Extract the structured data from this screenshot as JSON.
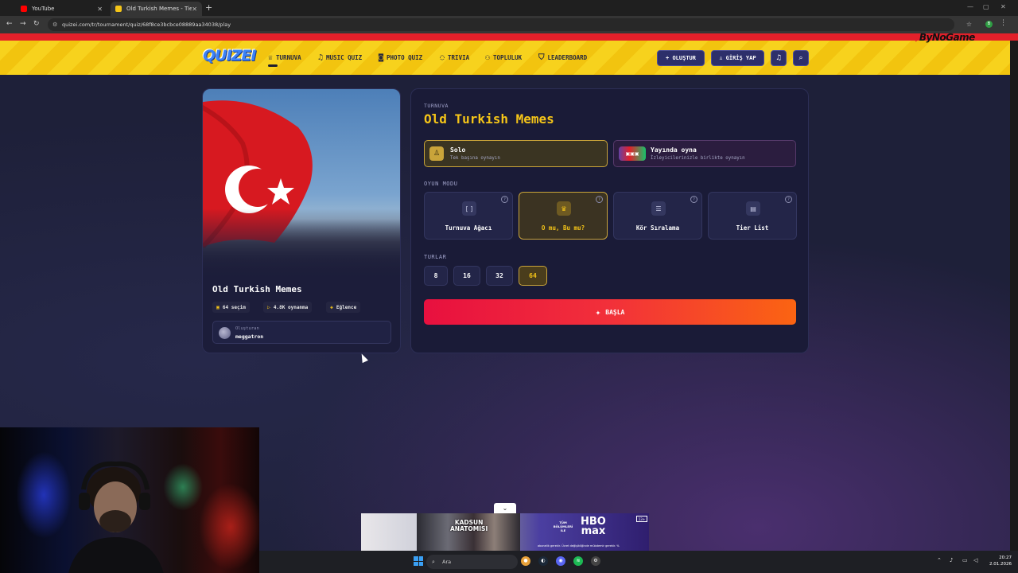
{
  "browser": {
    "tabs": [
      {
        "title": "YouTube",
        "favicon_color": "#ff0000",
        "active": false
      },
      {
        "title": "Old Turkish Memes - Tier List |",
        "favicon_color": "#f5c518",
        "active": true
      }
    ],
    "url": "quizei.com/tr/tournament/quiz/68f8ce3bcbce08889aa34038/play",
    "extension_letter": "B"
  },
  "header": {
    "logo": "QUIZEI",
    "nav": [
      {
        "label": "TURNUVA",
        "icon": "trophy-icon",
        "glyph": "♕"
      },
      {
        "label": "MUSIC QUIZ",
        "icon": "music-icon",
        "glyph": "♫"
      },
      {
        "label": "PHOTO QUIZ",
        "icon": "camera-icon",
        "glyph": "◙"
      },
      {
        "label": "TRIVIA",
        "icon": "chat-icon",
        "glyph": "◌"
      },
      {
        "label": "TOPLULUK",
        "icon": "users-icon",
        "glyph": "⚇"
      },
      {
        "label": "LEADERBOARD",
        "icon": "shield-icon",
        "glyph": "⛉"
      }
    ],
    "create_label": "+ OLUŞTUR",
    "login_label": "GİRİŞ YAP",
    "overlay_brand": "ByNoGame"
  },
  "quiz_card": {
    "title": "Old Turkish Memes",
    "stats": [
      {
        "icon": "images-icon",
        "glyph": "▣",
        "label": "64 seçim"
      },
      {
        "icon": "play-icon",
        "glyph": "▷",
        "label": "4.8K oynanma"
      },
      {
        "icon": "tag-icon",
        "glyph": "◈",
        "label": "Eğlence"
      }
    ],
    "creator_label": "Oluşturan",
    "creator_name": "meggatron"
  },
  "setup": {
    "kicker": "TURNUVA",
    "title": "Old Turkish Memes",
    "play_options": [
      {
        "title": "Solo",
        "subtitle": "Tek başına oynayın",
        "selected": true
      },
      {
        "title": "Yayında oyna",
        "subtitle": "İzleyicilerinizle birlikte oynayın",
        "selected": false
      }
    ],
    "mode_label": "OYUN MODU",
    "modes": [
      {
        "label": "Turnuva Ağacı",
        "glyph": "[ ]",
        "icon": "bracket-icon",
        "selected": false
      },
      {
        "label": "O mu, Bu mu?",
        "glyph": "♛",
        "icon": "crown-icon",
        "selected": true
      },
      {
        "label": "Kör Sıralama",
        "glyph": "☰",
        "icon": "ranking-list-icon",
        "selected": false
      },
      {
        "label": "Tier List",
        "glyph": "▤",
        "icon": "tier-list-icon",
        "selected": false
      }
    ],
    "rounds_label": "TURLAR",
    "rounds": [
      {
        "label": "8",
        "selected": false
      },
      {
        "label": "16",
        "selected": false
      },
      {
        "label": "32",
        "selected": false
      },
      {
        "label": "64",
        "selected": true
      }
    ],
    "start_label": "BAŞLA"
  },
  "ad": {
    "title_line1": "KADSUN",
    "title_line2": "ANATOMISI",
    "small_text": "TÜM BÖLÜMLERİ İLE",
    "brand_line1": "HBO",
    "brand_line2": "max",
    "badge": "13+",
    "footnote": "abonelik gerekir. Ücret değişikliğinde mübdemir gerekir. %"
  },
  "taskbar": {
    "search_placeholder": "Ara",
    "time": "20:27",
    "date": "2.01.2026"
  }
}
